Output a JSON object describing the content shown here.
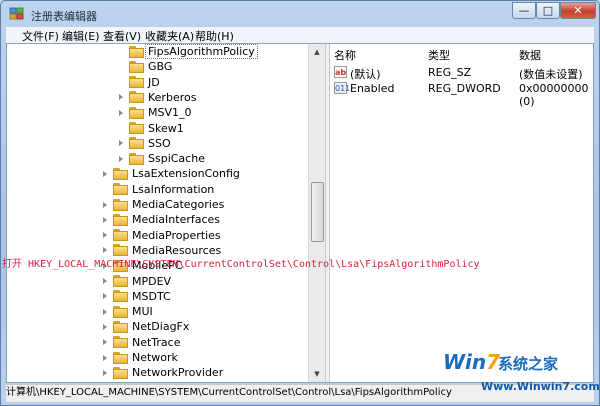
{
  "window": {
    "title": "注册表编辑器"
  },
  "controls": {
    "minimize": "—",
    "maximize": "□",
    "close": "✕"
  },
  "menu": [
    "文件(F)",
    "编辑(E)",
    "查看(V)",
    "收藏夹(A)",
    "帮助(H)"
  ],
  "tree": [
    {
      "label": "FipsAlgorithmPolicy",
      "level": 2,
      "expander": false,
      "selected": true
    },
    {
      "label": "GBG",
      "level": 2,
      "expander": false
    },
    {
      "label": "JD",
      "level": 2,
      "expander": false
    },
    {
      "label": "Kerberos",
      "level": 2,
      "expander": true
    },
    {
      "label": "MSV1_0",
      "level": 2,
      "expander": true
    },
    {
      "label": "Skew1",
      "level": 2,
      "expander": false
    },
    {
      "label": "SSO",
      "level": 2,
      "expander": true
    },
    {
      "label": "SspiCache",
      "level": 2,
      "expander": true
    },
    {
      "label": "LsaExtensionConfig",
      "level": 1,
      "expander": true
    },
    {
      "label": "LsaInformation",
      "level": 1,
      "expander": false
    },
    {
      "label": "MediaCategories",
      "level": 1,
      "expander": true
    },
    {
      "label": "MediaInterfaces",
      "level": 1,
      "expander": true
    },
    {
      "label": "MediaProperties",
      "level": 1,
      "expander": true
    },
    {
      "label": "MediaResources",
      "level": 1,
      "expander": true
    },
    {
      "label": "MobilePC",
      "level": 1,
      "expander": true
    },
    {
      "label": "MPDEV",
      "level": 1,
      "expander": true
    },
    {
      "label": "MSDTC",
      "level": 1,
      "expander": true
    },
    {
      "label": "MUI",
      "level": 1,
      "expander": true
    },
    {
      "label": "NetDiagFx",
      "level": 1,
      "expander": true
    },
    {
      "label": "NetTrace",
      "level": 1,
      "expander": true
    },
    {
      "label": "Network",
      "level": 1,
      "expander": true
    },
    {
      "label": "NetworkProvider",
      "level": 1,
      "expander": true
    }
  ],
  "columns": {
    "name": "名称",
    "type": "类型",
    "data": "数据"
  },
  "values": [
    {
      "icon": "ab",
      "name": "(默认)",
      "type": "REG_SZ",
      "data": "(数值未设置)"
    },
    {
      "icon": "011",
      "name": "Enabled",
      "type": "REG_DWORD",
      "data": "0x00000000 (0)"
    }
  ],
  "status": "计算机\\HKEY_LOCAL_MACHINE\\SYSTEM\\CurrentControlSet\\Control\\Lsa\\FipsAlgorithmPolicy",
  "overlay_text": "打开 HKEY_LOCAL_MACHINE\\SYSTEM\\CurrentControlSet\\Control\\Lsa\\FipsAlgorithmPolicy",
  "watermark": {
    "logo_w": "Win",
    "logo_7": "7",
    "cn": "系统之家",
    "url": "Www.Winwin7.com"
  }
}
